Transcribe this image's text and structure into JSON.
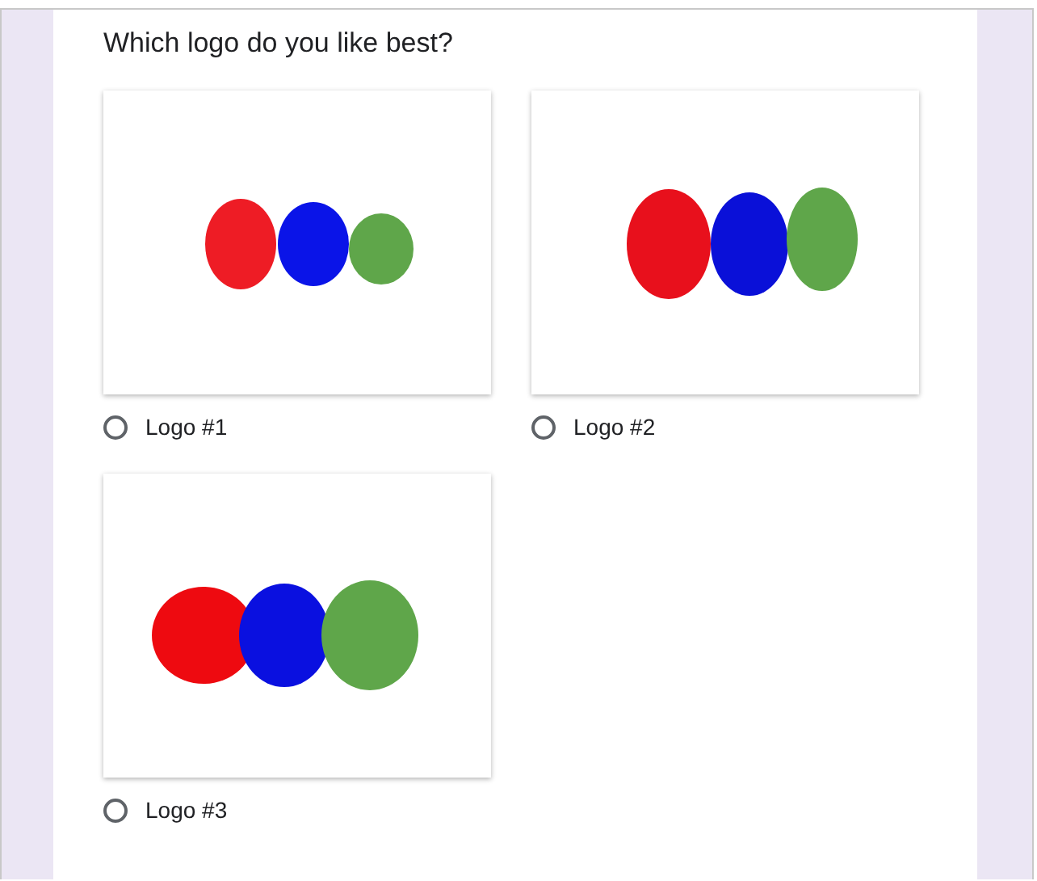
{
  "question": "Which logo do you like best?",
  "options": [
    {
      "label": "Logo #1",
      "selected": false,
      "kind": "picture"
    },
    {
      "label": "Logo #2",
      "selected": false,
      "kind": "picture"
    },
    {
      "label": "Logo #3",
      "selected": false,
      "kind": "picture"
    }
  ]
}
